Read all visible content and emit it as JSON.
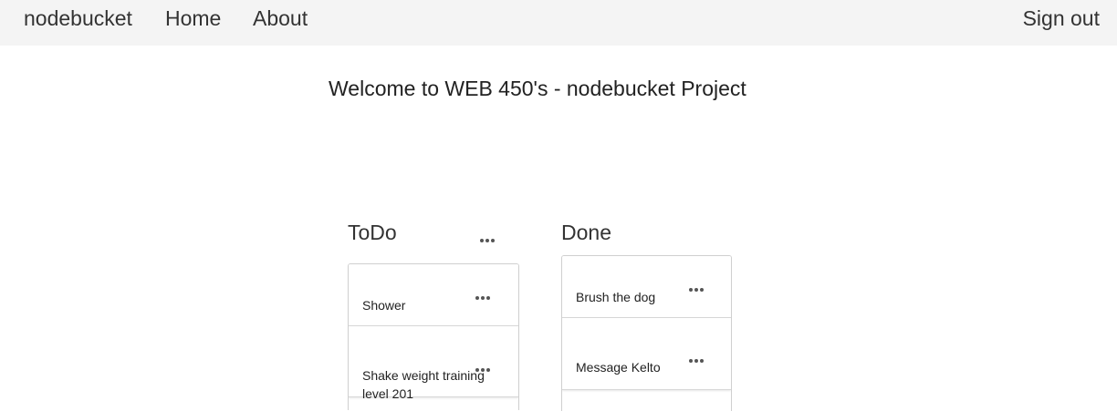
{
  "nav": {
    "brand": "nodebucket",
    "home": "Home",
    "about": "About",
    "signout": "Sign out"
  },
  "welcome": "Welcome to WEB 450's - nodebucket Project",
  "todo": {
    "title": "ToDo",
    "items": [
      "Shower",
      "Shake weight training level 201"
    ]
  },
  "done": {
    "title": "Done",
    "items": [
      "Brush the dog",
      "Message Kelto"
    ]
  },
  "icons": {
    "more": "more-horizontal-icon"
  }
}
